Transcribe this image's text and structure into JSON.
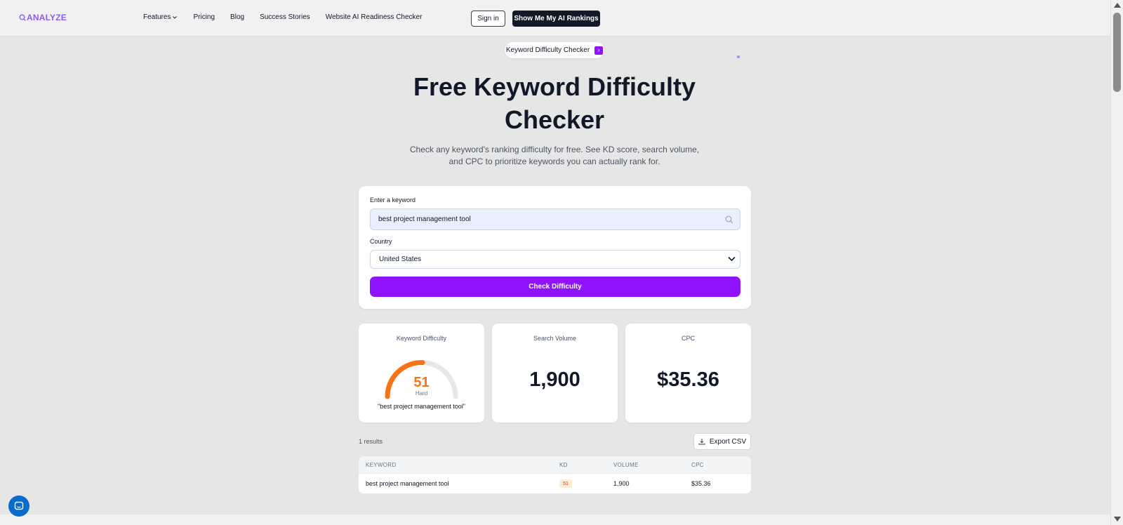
{
  "header": {
    "logo_text": "ANALYZE",
    "nav": {
      "features": "Features",
      "pricing": "Pricing",
      "blog": "Blog",
      "success_stories": "Success Stories",
      "readiness_checker": "Website AI Readiness Checker"
    },
    "signin_label": "Sign in",
    "cta_label": "Show Me My AI Rankings"
  },
  "badge": {
    "label": "Keyword Difficulty Checker",
    "arrow": "›"
  },
  "hero": {
    "title": "Free Keyword Difficulty Checker",
    "subtitle": "Check any keyword's ranking difficulty for free. See KD score, search volume, and CPC to prioritize keywords you can actually rank for."
  },
  "form": {
    "keyword_label": "Enter a keyword",
    "keyword_value": "best project management tool",
    "country_label": "Country",
    "country_value": "United States",
    "submit_label": "Check Difficulty"
  },
  "metrics": {
    "kd": {
      "label": "Keyword Difficulty",
      "value": "51",
      "level": "Hard",
      "keyword": "\"best project management tool\"",
      "score": 51,
      "max": 100
    },
    "volume": {
      "label": "Search Volume",
      "value": "1,900"
    },
    "cpc": {
      "label": "CPC",
      "value": "$35.36"
    }
  },
  "results": {
    "count_text": "1 results",
    "export_label": "Export CSV",
    "columns": {
      "keyword": "KEYWORD",
      "kd": "KD",
      "volume": "VOLUME",
      "cpc": "CPC"
    },
    "rows": [
      {
        "keyword": "best project management tool",
        "kd": "51",
        "volume": "1,900",
        "cpc": "$35.36"
      }
    ]
  },
  "colors": {
    "accent": "#9013fe",
    "kd_orange": "#f97316",
    "dark": "#111827",
    "chat": "#0b6bcb"
  },
  "icons": [
    "search-icon",
    "chevron-down-icon",
    "chevron-right-icon",
    "download-icon",
    "chat-icon"
  ]
}
